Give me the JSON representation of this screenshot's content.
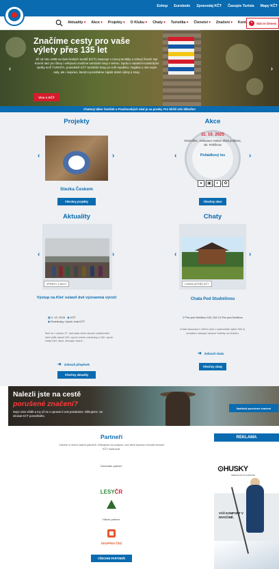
{
  "top_links": [
    "Eshop",
    "Eurobeds",
    "Zpravodaj KČT",
    "Časopis Turista",
    "Mapy KČT"
  ],
  "nav": {
    "items": [
      "Aktuality",
      "Akce",
      "Projekty",
      "O Klubu",
      "Chaty",
      "Turistika",
      "Členství",
      "Značení",
      "Kontakty"
    ],
    "login_label": "Stát se členem",
    "search_icon": "search-icon"
  },
  "hero": {
    "title": "Značíme cesty pro vaše výlety přes 135 let",
    "text": "Již od roku 1889 se Klub českých turistů (KČT) zasazuje o rozvoj turistiky a zdravý životní styl. Kromě akcí pro členy i veřejnost značíme turistické trasy v terénu. Spolu s ostatními turistickými spolky tvoří TURISTA, pravidelně KČT turistické trasy po celé republice. Najdete u nás nejen rady, ale i inspiraci, kterými pomáháme zajistit dobré výlety a trasy.",
    "button": "Více o KČT"
  },
  "info_banner": "Chatový tábor ženiček u Prachovských skal je na prodej. Pro bližší info klikněte!",
  "projects": {
    "title": "Projekty",
    "caption": "Stezka Českem",
    "button": "Všechny projekty"
  },
  "events": {
    "title": "Akce",
    "date": "11. 10. 2025",
    "place": "Hamroštec, restaurace Saloon Zlatá podkova, okr. Pelhřimov",
    "name": "Pohádkový les",
    "icons": [
      "♦",
      "▣",
      "◐",
      "✿"
    ],
    "button": "Všechny akce"
  },
  "news": {
    "title": "Aktuality",
    "tag": "ZPRÁVY Z AKCÍ",
    "headline": "Výstup na Kleť oslavil dvě významná výročí",
    "date": "2. 10. 2025",
    "author": "KČT",
    "category": "Rozhledny, Výročí chat KČT",
    "text": "Kleť se v sobotu 27. září stala cílem stovek návštěvníků, kteří přišli oslavit 200. výročí místní rozhledny a 100. výročí chaty Kleť. Akce, sledující časné...",
    "more": "Zobrazit příspěvek",
    "button": "Všechny aktuality"
  },
  "huts": {
    "title": "Chaty",
    "tag": "CHATA (ÚTRÉ) KČT",
    "name": "Chata Pod Studničnou",
    "address": "Pec pod Sněžkou 120, 542 21 Pec pod Sněžkou",
    "text": "Chata situovaná v Obřím dole v nadmořské výšce 900 m, nedaleko nástupní stezice Sněžky na Sněžku.",
    "more": "Zobrazit chatu",
    "button": "Všechny chaty"
  },
  "report": {
    "title": "Nalezli jste na cestě",
    "title_red": "porušené značení?",
    "text": "Dejte nám vědět a my už se o opravení cest postaráme. Děkujeme. Se sítokuk KČT pomoštněte.",
    "button": "Nahlásit porušené značení"
  },
  "partners": {
    "title": "Partneři",
    "text": "Vážíme si všech našich partnerů. Děkujeme za podporu, bez které bychom nemohli činnost KČT realizovat.",
    "general_label": "Generální partner:",
    "lesy_a": "LESY",
    "lesy_b": "ČR",
    "main_label": "Hlavní partner:",
    "cez": "SKUPINA ČEZ",
    "button": "VŠECHNI PARTNEŘI"
  },
  "ad": {
    "head": "REKLAMA",
    "brand": "⊙HUSKY",
    "sub": "SPECIALIST IN OUTDOOR",
    "slogan": "VÁŠ KOMFORT V DIVOČINĚ."
  },
  "colors": {
    "primary": "#0a6bb0",
    "accent": "#d51b2b"
  }
}
